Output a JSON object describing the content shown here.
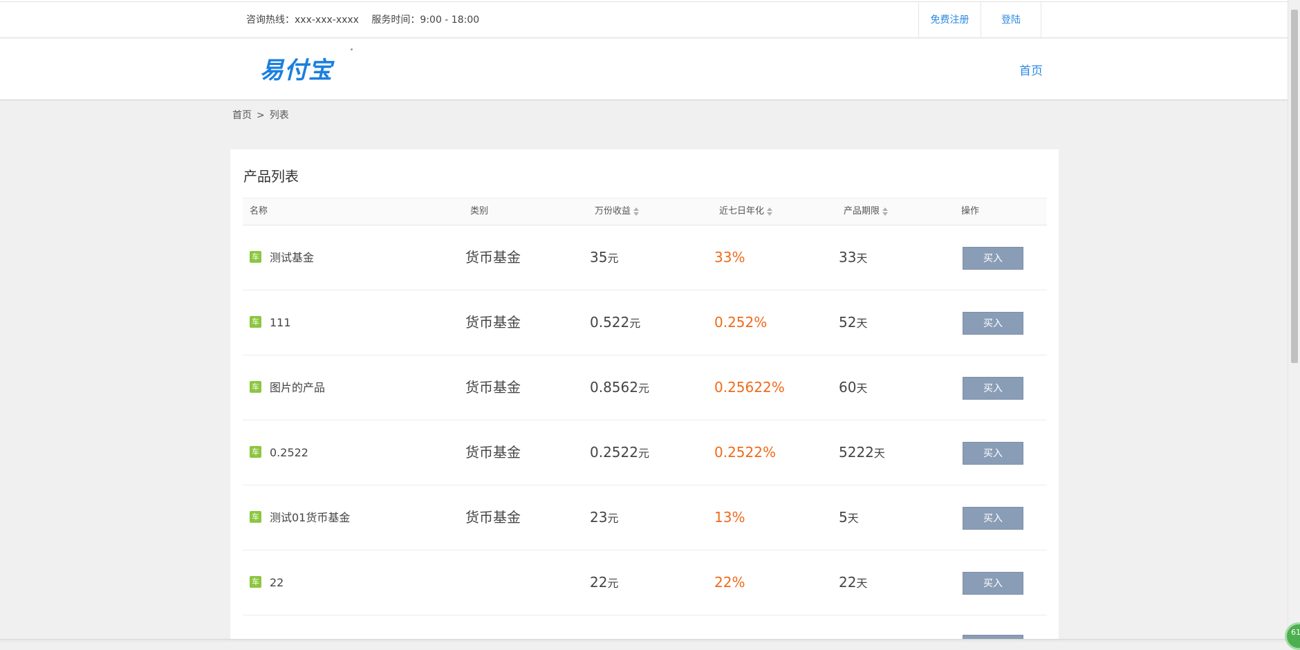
{
  "topbar": {
    "hotline": "咨询热线：xxx-xxx-xxxx",
    "service_hours": "服务时间：9:00 - 18:00",
    "register_label": "免费注册",
    "login_label": "登陆"
  },
  "header": {
    "logo_text": "易付宝",
    "nav_home": "首页"
  },
  "breadcrumb": {
    "home": "首页",
    "separator": ">",
    "current": "列表"
  },
  "panel": {
    "title": "产品列表"
  },
  "table": {
    "columns": [
      "名称",
      "类别",
      "万份收益",
      "近七日年化",
      "产品期限",
      "操作"
    ],
    "tag_label": "车",
    "buy_label": "买入",
    "income_unit": "元",
    "term_unit": "天",
    "rows": [
      {
        "name": "测试基金",
        "type": "货币基金",
        "income": "35",
        "rate": "33%",
        "term": "33"
      },
      {
        "name": "111",
        "type": "货币基金",
        "income": "0.522",
        "rate": "0.252%",
        "term": "52"
      },
      {
        "name": "图片的产品",
        "type": "货币基金",
        "income": "0.8562",
        "rate": "0.25622%",
        "term": "60"
      },
      {
        "name": "0.2522",
        "type": "货币基金",
        "income": "0.2522",
        "rate": "0.2522%",
        "term": "5222"
      },
      {
        "name": "测试01货币基金",
        "type": "货币基金",
        "income": "23",
        "rate": "13%",
        "term": "5"
      },
      {
        "name": "22",
        "type": "",
        "income": "22",
        "rate": "22%",
        "term": "22"
      }
    ]
  },
  "colors": {
    "link": "#2b8ae0",
    "rate": "#f06a1a",
    "tag": "#8cc63f",
    "button": "#8a9db7"
  },
  "badge_text": "61"
}
